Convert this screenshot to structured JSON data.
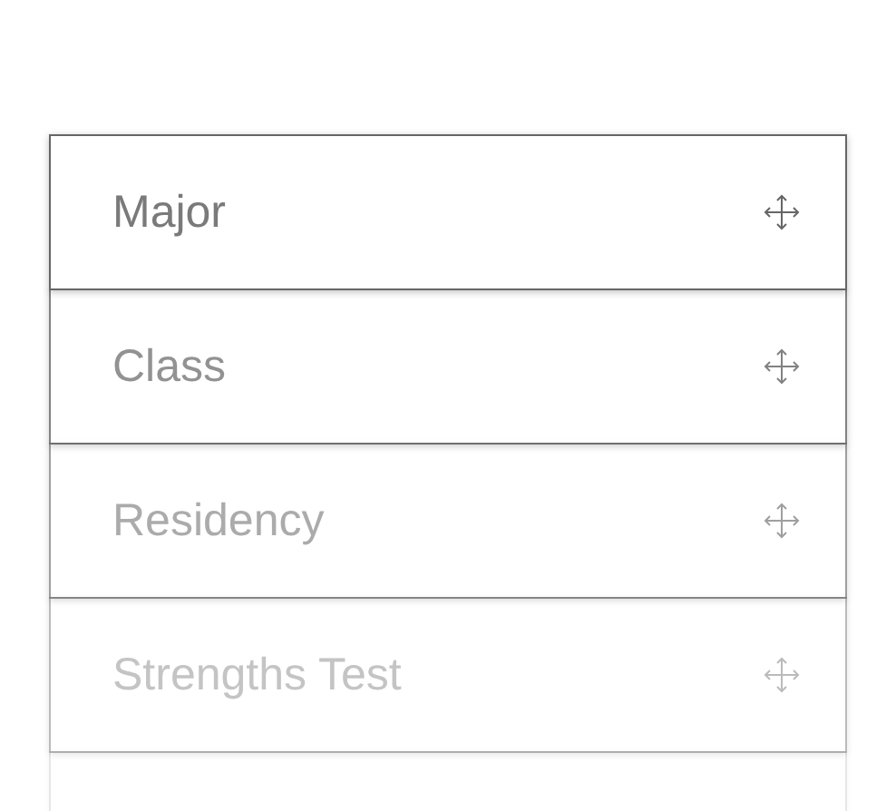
{
  "items": [
    {
      "label": "Major"
    },
    {
      "label": "Class"
    },
    {
      "label": "Residency"
    },
    {
      "label": "Strengths Test"
    }
  ]
}
